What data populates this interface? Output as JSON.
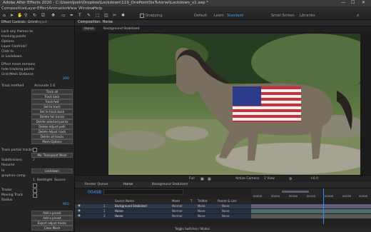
{
  "titlebar": {
    "title": "Adobe After Effects 2020 - C:\\Users\\Josh\\Dropbox\\Lockdown\\119_OnePointSixTutorial\\Lockdown_v1.aep *"
  },
  "menus": [
    "Composition",
    "Layer",
    "Effect",
    "Animation",
    "View",
    "Window",
    "Help"
  ],
  "workspaces": {
    "items": [
      "Default",
      "Learn",
      "Standard",
      "Small Screen",
      "Libraries"
    ],
    "active": "Standard"
  },
  "snapping_label": "Snapping",
  "left_panel": {
    "tab": "Effect Controls: Grime",
    "tab2": "Project",
    "lines": [
      "Lock any frames to",
      "tracking points",
      "Options",
      "Layer Controls?",
      "Click to",
      "in Lockdown.",
      "",
      "Effect mesh remains",
      "hide tracking points",
      "Grid Mesh Distance"
    ],
    "value_200": "200",
    "track_method": "Track method",
    "accurate": "Accurate 1.6",
    "buttons": [
      "Track all",
      "Track back",
      "Track fwd",
      "Set to track",
      "Set to track back",
      "Delete full tracks",
      "Delete selected points",
      "Delete Adjust path",
      "Delete Adjust track",
      "Delete all tracks",
      "Mesh Options"
    ],
    "partial_tracks": "Track partial tracks",
    "track_mode_btn": "Mx: Transplant Mesh",
    "subdivisions": "Subdivisions",
    "value_2": "2",
    "resume": "Resume",
    "lock_btn": "Lockdown",
    "graphics_comp": "graphics comp",
    "backlight": "1. Backlight",
    "source": "Source",
    "tracks_label": "Tracks",
    "moving_track": "Moving Track",
    "radius": "Radius",
    "value_903": "903",
    "bottom_buttons": [
      "Add a preset",
      "Add a preset",
      "Export adjust tracks",
      "Clear Mesh"
    ]
  },
  "composition": {
    "tab": "Composition: Horse",
    "subtab": "Horse",
    "layer_tab": "Background Stabilized"
  },
  "viewbar": {
    "zoom": "Full",
    "camera": "Active Camera",
    "view": "1 View",
    "exposure": "+0.0"
  },
  "timeline": {
    "render_queue": "Render Queue",
    "tab_horse": "Horse",
    "tab_bg": "Background Stabilized",
    "timecode": "00498",
    "col_source": "Source Name",
    "col_mode": "Mode",
    "col_t": "T",
    "col_trkmat": "TrkMat",
    "col_parent": "Parent & Link",
    "layers": [
      {
        "num": "1",
        "name": "Background Stabilized",
        "mode": "Normal",
        "trkmat": "None",
        "parent": "None"
      },
      {
        "num": "2",
        "name": "Horse",
        "mode": "Normal",
        "trkmat": "None",
        "parent": "None"
      },
      {
        "num": "3",
        "name": "Horse",
        "mode": "Normal",
        "trkmat": "None",
        "parent": "None"
      }
    ],
    "ruler": [
      "00000",
      "00050",
      "00100",
      "00150",
      "00200",
      "00250",
      "00300"
    ],
    "toggle_label": "Toggle Switches / Modes"
  },
  "colors": {
    "accent": "#3aa0ff",
    "track_bar": "#5e5e7a",
    "playhead": "#2c8cff"
  }
}
